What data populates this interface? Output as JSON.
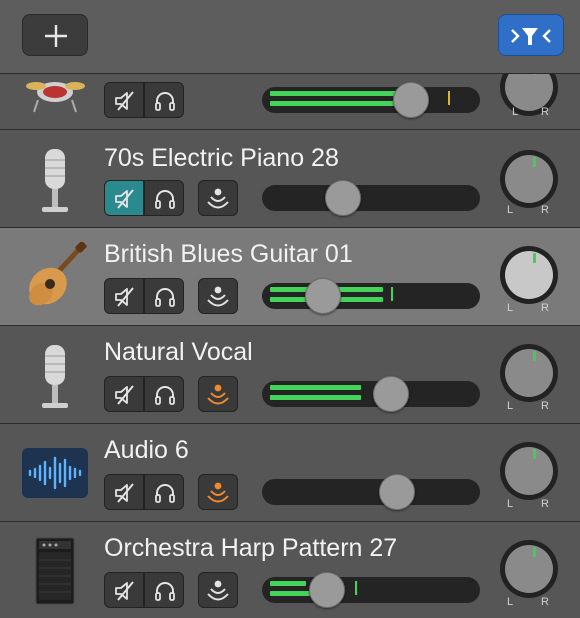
{
  "header": {
    "add_button_icon": "plus-icon",
    "filter_button_icon": "track-header-filter-icon",
    "accent_color": "#2f6fc8"
  },
  "pan_labels": {
    "left": "L",
    "right": "R"
  },
  "tracks": [
    {
      "name": "",
      "icon": "drum-kit-icon",
      "muted": false,
      "record_enabled": null,
      "volume": 0.7,
      "meter": 0.68,
      "meter2": 0.66,
      "peak": 0.88,
      "peak_color": "#e2b62a"
    },
    {
      "name": "70s Electric Piano 28",
      "icon": "microphone-icon",
      "muted": true,
      "record_enabled": false,
      "volume": 0.36,
      "meter": 0,
      "meter2": 0,
      "peak": null,
      "peak_color": null
    },
    {
      "name": "British Blues Guitar 01",
      "icon": "acoustic-guitar-icon",
      "selected": true,
      "muted": false,
      "record_enabled": false,
      "volume": 0.26,
      "meter": 0.56,
      "meter2": 0.56,
      "peak": 0.6,
      "peak_color": "#45d45a"
    },
    {
      "name": "Natural Vocal",
      "icon": "microphone-icon",
      "muted": false,
      "record_enabled": true,
      "volume": 0.6,
      "meter": 0.45,
      "meter2": 0.45,
      "peak": 0.54,
      "peak_color": "#45d45a"
    },
    {
      "name": "Audio 6",
      "icon": "audio-waveform-icon",
      "muted": false,
      "record_enabled": true,
      "volume": 0.63,
      "meter": 0,
      "meter2": 0,
      "peak": null,
      "peak_color": null
    },
    {
      "name": "Orchestra Harp Pattern 27",
      "icon": "amplifier-icon",
      "muted": false,
      "record_enabled": false,
      "volume": 0.28,
      "meter": 0.18,
      "meter2": 0.25,
      "peak": 0.42,
      "peak_color": "#45d45a"
    }
  ]
}
